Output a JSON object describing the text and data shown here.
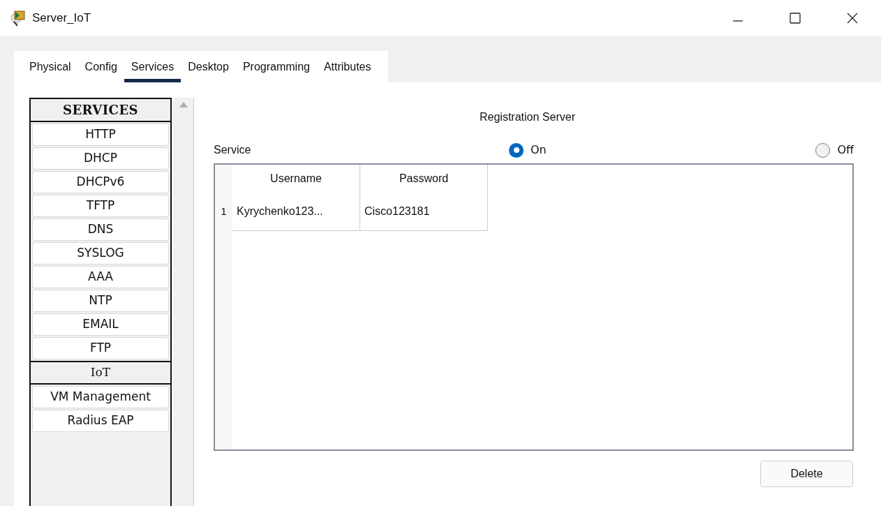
{
  "window": {
    "title": "Server_IoT"
  },
  "tabs": [
    {
      "label": "Physical",
      "selected": false
    },
    {
      "label": "Config",
      "selected": false
    },
    {
      "label": "Services",
      "selected": true
    },
    {
      "label": "Desktop",
      "selected": false
    },
    {
      "label": "Programming",
      "selected": false
    },
    {
      "label": "Attributes",
      "selected": false
    }
  ],
  "sidebar": {
    "header": "SERVICES",
    "items": [
      {
        "label": "HTTP",
        "selected": false
      },
      {
        "label": "DHCP",
        "selected": false
      },
      {
        "label": "DHCPv6",
        "selected": false
      },
      {
        "label": "TFTP",
        "selected": false
      },
      {
        "label": "DNS",
        "selected": false
      },
      {
        "label": "SYSLOG",
        "selected": false
      },
      {
        "label": "AAA",
        "selected": false
      },
      {
        "label": "NTP",
        "selected": false
      },
      {
        "label": "EMAIL",
        "selected": false
      },
      {
        "label": "FTP",
        "selected": false
      },
      {
        "label": "IoT",
        "selected": true
      },
      {
        "label": "VM Management",
        "selected": false
      },
      {
        "label": "Radius EAP",
        "selected": false
      }
    ]
  },
  "panel": {
    "title": "Registration Server",
    "service_label": "Service",
    "options": [
      {
        "label": "On",
        "selected": true
      },
      {
        "label": "Off",
        "selected": false
      }
    ],
    "table": {
      "columns": [
        "Username",
        "Password"
      ],
      "rows": [
        {
          "number": "1",
          "cells": [
            "Kyrychenko123...",
            "Cisco123181"
          ]
        }
      ]
    },
    "delete_button": "Delete"
  }
}
